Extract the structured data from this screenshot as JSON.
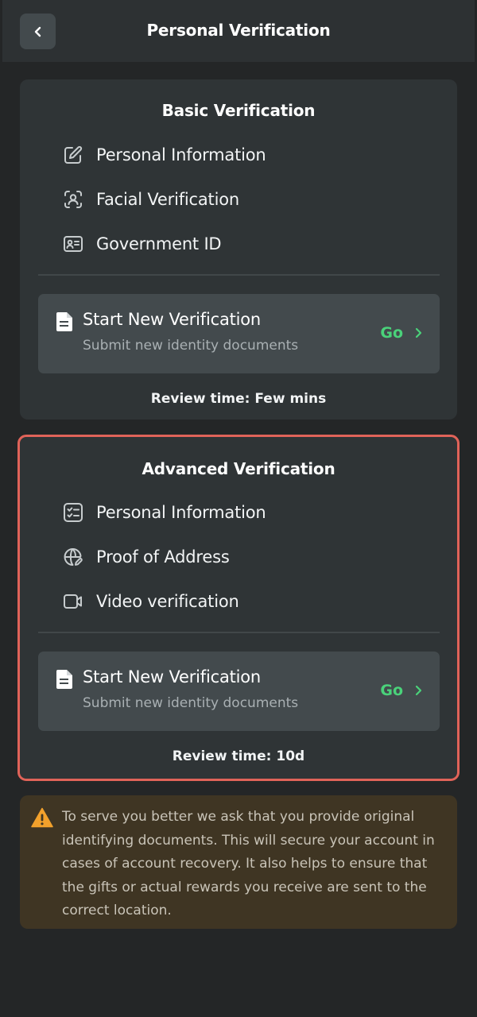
{
  "header": {
    "title": "Personal Verification",
    "back_icon": "chevron-left-icon"
  },
  "basic": {
    "title": "Basic Verification",
    "steps": [
      {
        "label": "Personal Information",
        "icon": "edit-icon"
      },
      {
        "label": "Facial Verification",
        "icon": "face-scan-icon"
      },
      {
        "label": "Government ID",
        "icon": "id-card-icon"
      }
    ],
    "start": {
      "title": "Start New Verification",
      "subtitle": "Submit new identity documents",
      "go": "Go"
    },
    "review": "Review time: Few mins"
  },
  "advanced": {
    "title": "Advanced Verification",
    "steps": [
      {
        "label": "Personal Information",
        "icon": "checklist-icon"
      },
      {
        "label": "Proof of Address",
        "icon": "globe-edit-icon"
      },
      {
        "label": "Video verification",
        "icon": "video-icon"
      }
    ],
    "start": {
      "title": "Start New Verification",
      "subtitle": "Submit new identity documents",
      "go": "Go"
    },
    "review": "Review time: 10d"
  },
  "notice": {
    "text": "To serve you better we ask that you provide original identifying documents. This will secure your account in cases of account recovery. It also helps to ensure that the gifts or actual rewards you receive are sent to the correct location."
  },
  "colors": {
    "background": "#242627",
    "card": "#2f3436",
    "panel": "#434a4d",
    "accent_green": "#4ad27a",
    "highlight_red": "#e06359",
    "warning_orange": "#f2a12c",
    "notice_bg": "#3f3523"
  }
}
